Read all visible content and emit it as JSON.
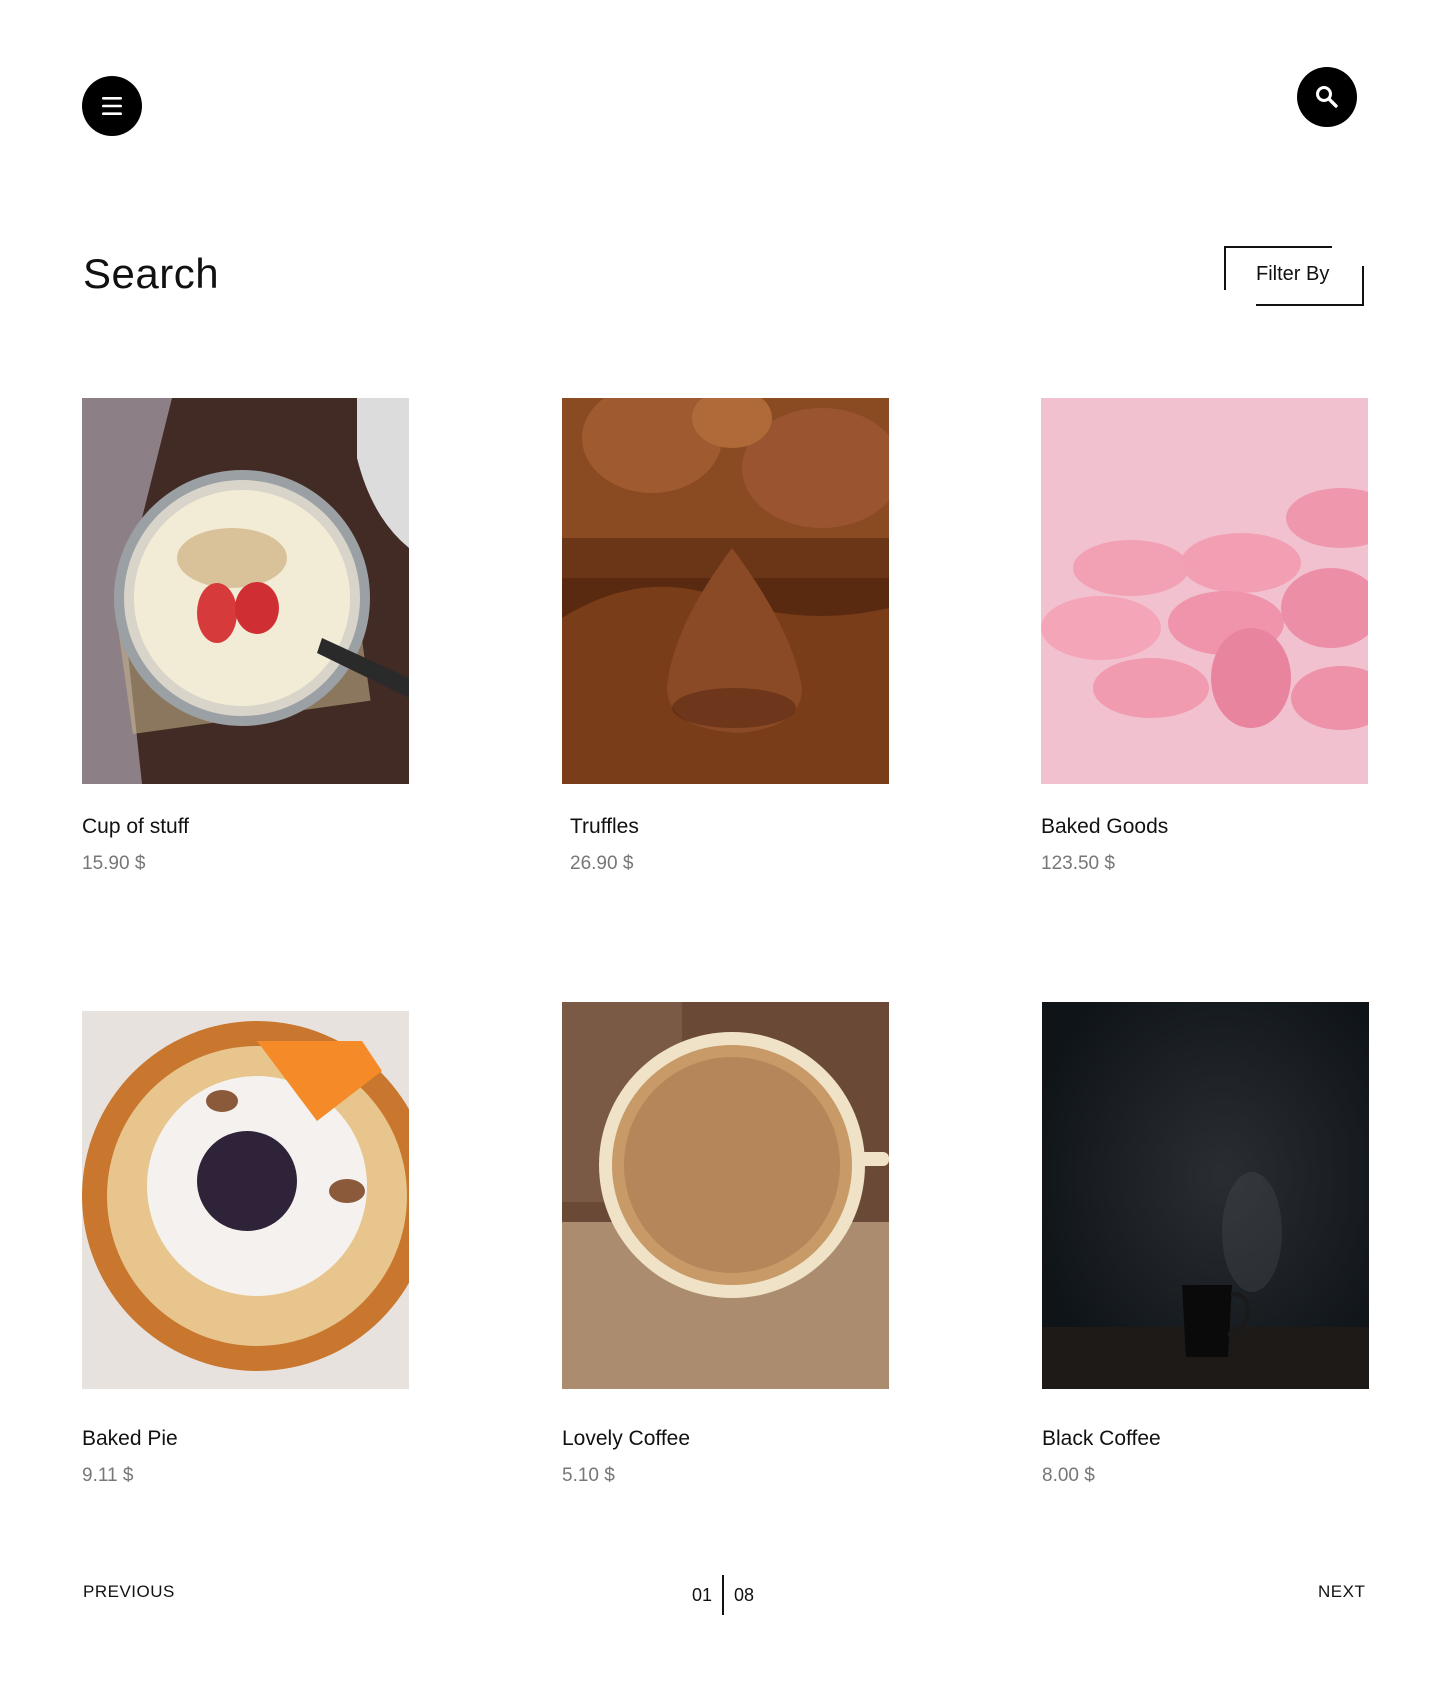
{
  "header": {
    "menu_icon": "hamburger-menu-icon",
    "search_icon": "search-icon"
  },
  "page": {
    "title": "Search",
    "filter_label": "Filter By"
  },
  "products": [
    {
      "name": "Cup of stuff",
      "price": "15.90 $",
      "image": "yogurt-bowl-with-strawberries-oats"
    },
    {
      "name": "Truffles",
      "price": "26.90 $",
      "image": "cocoa-truffle-in-powder"
    },
    {
      "name": "Baked Goods",
      "price": "123.50 $",
      "image": "pink-macarons"
    },
    {
      "name": "Baked Pie",
      "price": "9.11 $",
      "image": "pie-with-blueberries-almonds"
    },
    {
      "name": "Lovely Coffee",
      "price": "5.10 $",
      "image": "latte-cup-top-view"
    },
    {
      "name": "Black Coffee",
      "price": "8.00 $",
      "image": "steaming-cup-dark-background"
    }
  ],
  "pagination": {
    "previous": "PREVIOUS",
    "next": "NEXT",
    "current": "01",
    "total": "08"
  }
}
